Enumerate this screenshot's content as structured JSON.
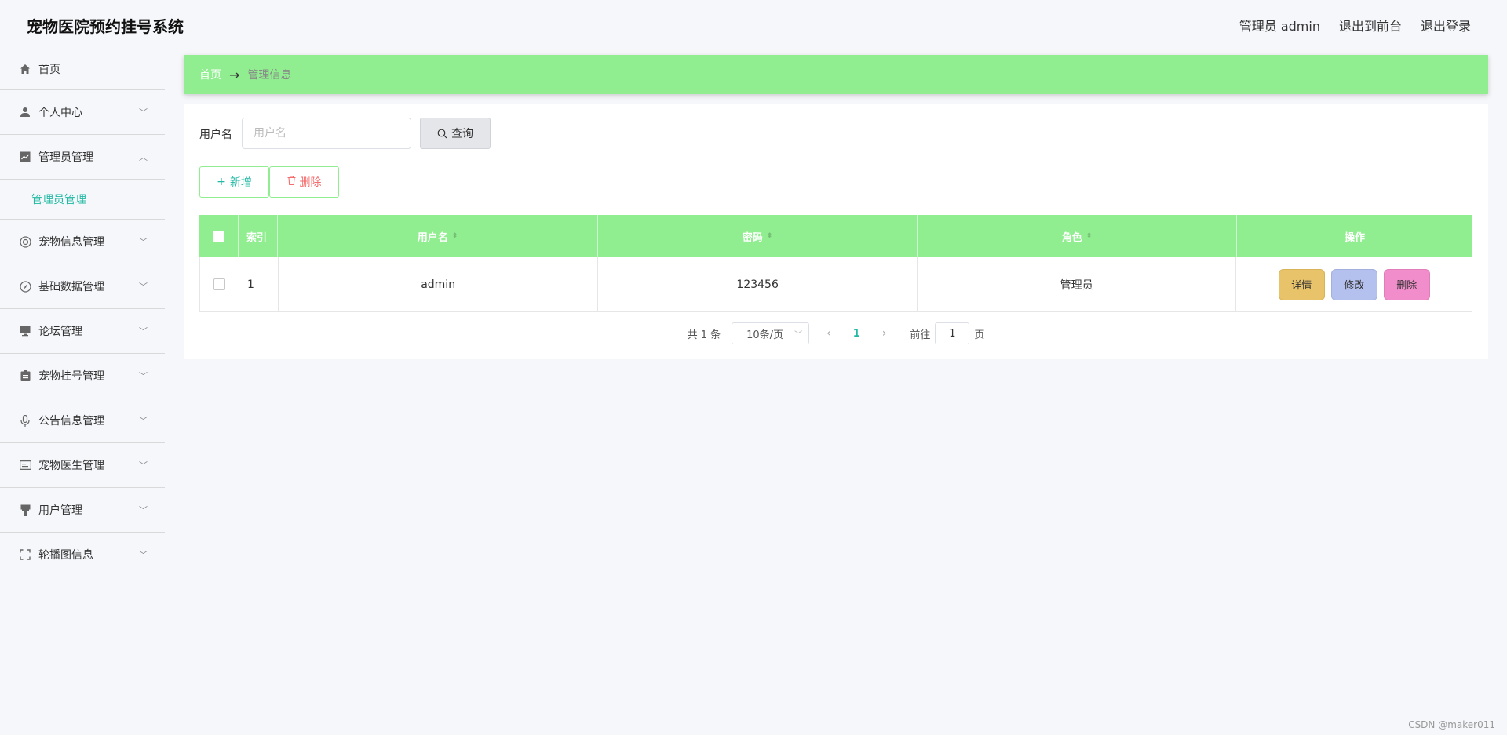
{
  "app": {
    "title": "宠物医院预约挂号系统"
  },
  "header": {
    "user_label": "管理员 admin",
    "front_link": "退出到前台",
    "logout_link": "退出登录"
  },
  "sidebar": {
    "items": [
      {
        "label": "首页",
        "icon": "home-icon"
      },
      {
        "label": "个人中心",
        "icon": "user-icon"
      },
      {
        "label": "管理员管理",
        "icon": "chart-icon",
        "expanded": true,
        "children": [
          "管理员管理"
        ]
      },
      {
        "label": "宠物信息管理",
        "icon": "target-icon"
      },
      {
        "label": "基础数据管理",
        "icon": "compass-icon"
      },
      {
        "label": "论坛管理",
        "icon": "monitor-icon"
      },
      {
        "label": "宠物挂号管理",
        "icon": "clipboard-icon"
      },
      {
        "label": "公告信息管理",
        "icon": "microphone-icon"
      },
      {
        "label": "宠物医生管理",
        "icon": "id-card-icon"
      },
      {
        "label": "用户管理",
        "icon": "brush-icon"
      },
      {
        "label": "轮播图信息",
        "icon": "fullscreen-icon"
      }
    ]
  },
  "breadcrumb": {
    "home": "首页",
    "arrow": "→",
    "current": "管理信息"
  },
  "search": {
    "label": "用户名",
    "placeholder": "用户名",
    "button": "查询"
  },
  "actions": {
    "add": "新增",
    "delete": "删除"
  },
  "table": {
    "columns": {
      "index": "索引",
      "username": "用户名",
      "password": "密码",
      "role": "角色",
      "ops": "操作"
    },
    "rows": [
      {
        "index": "1",
        "username": "admin",
        "password": "123456",
        "role": "管理员"
      }
    ],
    "row_actions": {
      "detail": "详情",
      "edit": "修改",
      "delete": "删除"
    }
  },
  "pagination": {
    "total": "共 1 条",
    "page_size": "10条/页",
    "current_page": "1",
    "goto_prefix": "前往",
    "goto_value": "1",
    "goto_suffix": "页"
  },
  "colors": {
    "accent_green": "#90ee90",
    "teal": "#21b8a4",
    "detail": "#e8c36a",
    "edit": "#b4c0ee",
    "delete": "#f08dca"
  },
  "watermark": "CSDN @maker011"
}
